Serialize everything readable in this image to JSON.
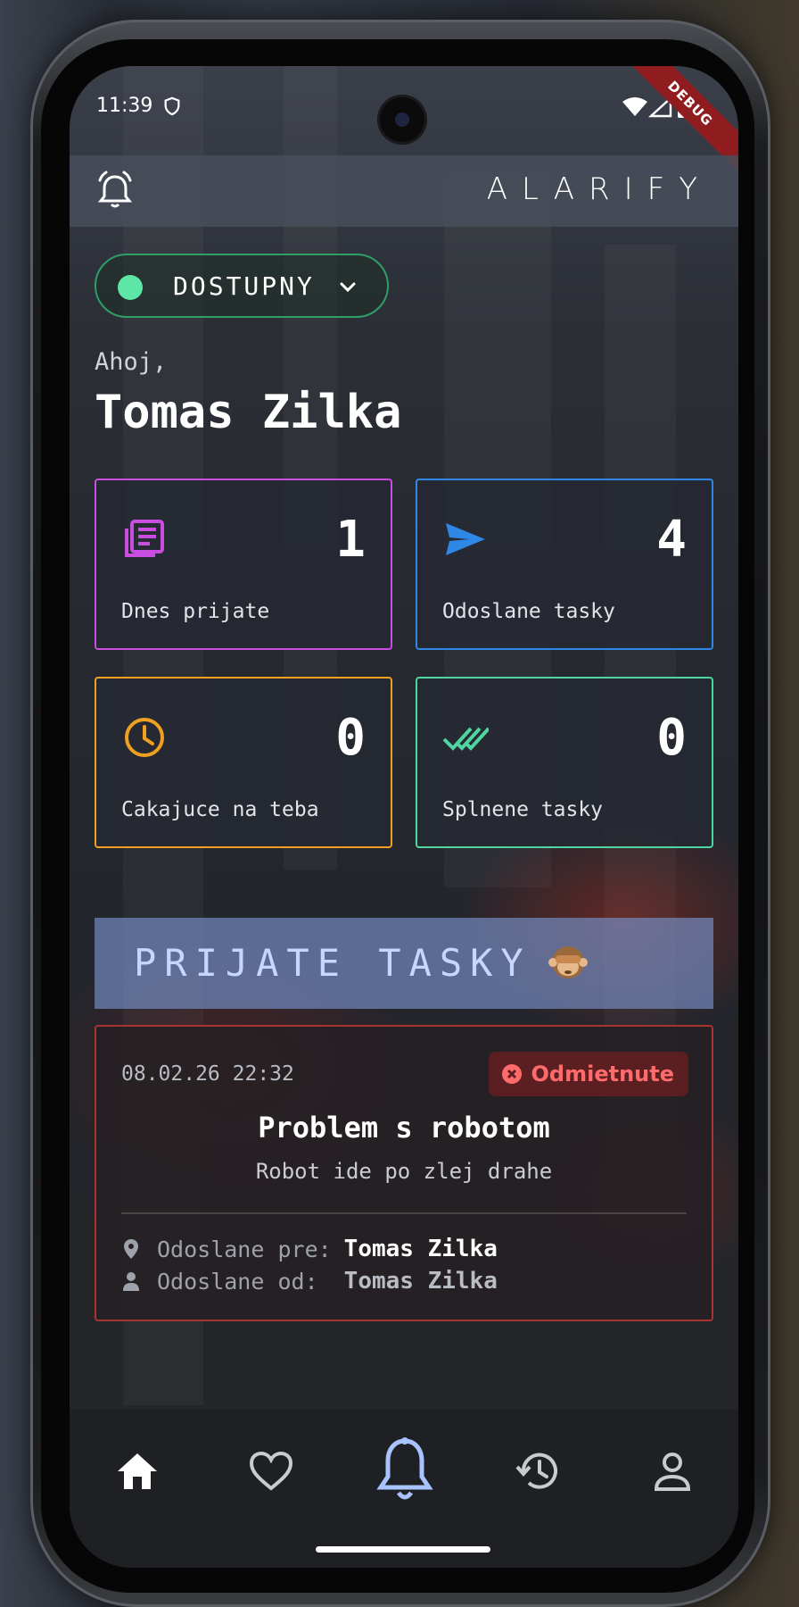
{
  "status_bar": {
    "time": "11:39",
    "debug_label": "DEBUG"
  },
  "app_bar": {
    "logo": "ALARIFY"
  },
  "availability": {
    "label": "DOSTUPNY",
    "dot_color": "#5ee6a6"
  },
  "greeting": {
    "hello": "Ahoj,",
    "name": "Tomas Zilka"
  },
  "stats": [
    {
      "icon": "newspaper-icon",
      "value": "1",
      "label": "Dnes prijate",
      "color": "#c94de0"
    },
    {
      "icon": "send-icon",
      "value": "4",
      "label": "Odoslane tasky",
      "color": "#2f88e6"
    },
    {
      "icon": "clock-icon",
      "value": "0",
      "label": "Cakajuce na teba",
      "color": "#f0a020"
    },
    {
      "icon": "double-check-icon",
      "value": "0",
      "label": "Splnene tasky",
      "color": "#4fd6a0"
    }
  ],
  "section": {
    "title": "PRIJATE TASKY",
    "emoji_icon": "see-no-evil-monkey-icon"
  },
  "task": {
    "date": "08.02.26 22:32",
    "status": "Odmietnute",
    "status_color": "#ff6b6b",
    "title": "Problem s robotom",
    "description": "Robot ide po zlej drahe",
    "sent_to_label": "Odoslane pre:",
    "sent_to_value": "Tomas Zilka",
    "sent_from_label": "Odoslane od: ",
    "sent_from_value": "Tomas Zilka"
  },
  "bottom_nav": {
    "items": [
      {
        "name": "home",
        "icon": "home-icon",
        "active": true
      },
      {
        "name": "favorites",
        "icon": "heart-icon",
        "active": false
      },
      {
        "name": "alarm",
        "icon": "bell-icon",
        "active": false
      },
      {
        "name": "history",
        "icon": "history-icon",
        "active": false
      },
      {
        "name": "profile",
        "icon": "person-icon",
        "active": false
      }
    ]
  },
  "colors": {
    "accent_blue": "#a9c3ff",
    "section_bg": "#748ec4",
    "reject_border": "#a63532"
  }
}
